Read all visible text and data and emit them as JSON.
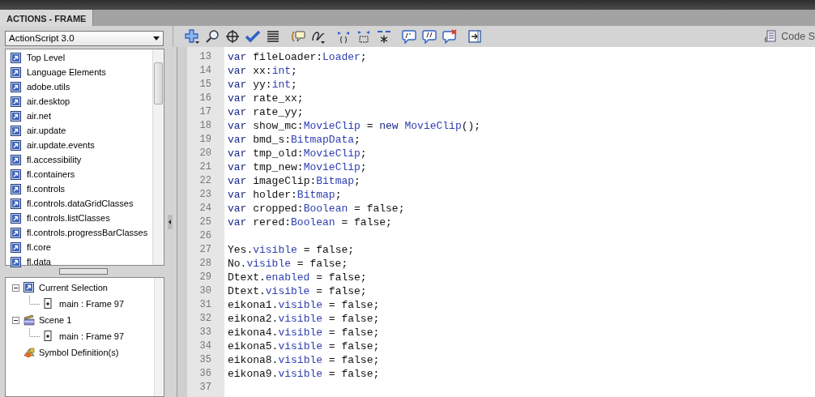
{
  "panel_tab": {
    "label": "ACTIONS - FRAME",
    "selected": true
  },
  "language_select": {
    "value": "ActionScript 3.0"
  },
  "toolbox_items": [
    {
      "label": "Top Level"
    },
    {
      "label": "Language Elements"
    },
    {
      "label": "adobe.utils"
    },
    {
      "label": "air.desktop"
    },
    {
      "label": "air.net"
    },
    {
      "label": "air.update"
    },
    {
      "label": "air.update.events"
    },
    {
      "label": "fl.accessibility"
    },
    {
      "label": "fl.containers"
    },
    {
      "label": "fl.controls"
    },
    {
      "label": "fl.controls.dataGridClasses"
    },
    {
      "label": "fl.controls.listClasses"
    },
    {
      "label": "fl.controls.progressBarClasses"
    },
    {
      "label": "fl.core"
    },
    {
      "label": "fl.data"
    }
  ],
  "script_tree": [
    {
      "label": "Current Selection",
      "kind": "selection",
      "expanded": true,
      "children": [
        {
          "label": "main : Frame 97",
          "kind": "frame"
        }
      ]
    },
    {
      "label": "Scene 1",
      "kind": "scene",
      "expanded": true,
      "children": [
        {
          "label": "main : Frame 97",
          "kind": "frame"
        }
      ]
    },
    {
      "label": "Symbol Definition(s)",
      "kind": "symbol"
    }
  ],
  "code_snippets_button": {
    "label": "Code S"
  },
  "code_lines": [
    {
      "number": "13",
      "tokens": [
        {
          "text": "var ",
          "kind": "keyword"
        },
        {
          "text": "fileLoader:",
          "kind": "plain"
        },
        {
          "text": "Loader",
          "kind": "type"
        },
        {
          "text": ";",
          "kind": "plain"
        }
      ]
    },
    {
      "number": "14",
      "tokens": [
        {
          "text": "var ",
          "kind": "keyword"
        },
        {
          "text": "xx:",
          "kind": "plain"
        },
        {
          "text": "int",
          "kind": "type"
        },
        {
          "text": ";",
          "kind": "plain"
        }
      ]
    },
    {
      "number": "15",
      "tokens": [
        {
          "text": "var ",
          "kind": "keyword"
        },
        {
          "text": "yy:",
          "kind": "plain"
        },
        {
          "text": "int",
          "kind": "type"
        },
        {
          "text": ";",
          "kind": "plain"
        }
      ]
    },
    {
      "number": "16",
      "tokens": [
        {
          "text": "var ",
          "kind": "keyword"
        },
        {
          "text": "rate_xx;",
          "kind": "plain"
        }
      ]
    },
    {
      "number": "17",
      "tokens": [
        {
          "text": "var ",
          "kind": "keyword"
        },
        {
          "text": "rate_yy;",
          "kind": "plain"
        }
      ]
    },
    {
      "number": "18",
      "tokens": [
        {
          "text": "var ",
          "kind": "keyword"
        },
        {
          "text": "show_mc:",
          "kind": "plain"
        },
        {
          "text": "MovieClip",
          "kind": "type"
        },
        {
          "text": " = ",
          "kind": "plain"
        },
        {
          "text": "new",
          "kind": "keyword"
        },
        {
          "text": " MovieClip",
          "kind": "type"
        },
        {
          "text": "();",
          "kind": "plain"
        }
      ]
    },
    {
      "number": "19",
      "tokens": [
        {
          "text": "var ",
          "kind": "keyword"
        },
        {
          "text": "bmd_s:",
          "kind": "plain"
        },
        {
          "text": "BitmapData",
          "kind": "type"
        },
        {
          "text": ";",
          "kind": "plain"
        }
      ]
    },
    {
      "number": "20",
      "tokens": [
        {
          "text": "var ",
          "kind": "keyword"
        },
        {
          "text": "tmp_old:",
          "kind": "plain"
        },
        {
          "text": "MovieClip",
          "kind": "type"
        },
        {
          "text": ";",
          "kind": "plain"
        }
      ]
    },
    {
      "number": "21",
      "tokens": [
        {
          "text": "var ",
          "kind": "keyword"
        },
        {
          "text": "tmp_new:",
          "kind": "plain"
        },
        {
          "text": "MovieClip",
          "kind": "type"
        },
        {
          "text": ";",
          "kind": "plain"
        }
      ]
    },
    {
      "number": "22",
      "tokens": [
        {
          "text": "var ",
          "kind": "keyword"
        },
        {
          "text": "imageClip:",
          "kind": "plain"
        },
        {
          "text": "Bitmap",
          "kind": "type"
        },
        {
          "text": ";",
          "kind": "plain"
        }
      ]
    },
    {
      "number": "23",
      "tokens": [
        {
          "text": "var ",
          "kind": "keyword"
        },
        {
          "text": "holder:",
          "kind": "plain"
        },
        {
          "text": "Bitmap",
          "kind": "type"
        },
        {
          "text": ";",
          "kind": "plain"
        }
      ]
    },
    {
      "number": "24",
      "tokens": [
        {
          "text": "var ",
          "kind": "keyword"
        },
        {
          "text": "cropped:",
          "kind": "plain"
        },
        {
          "text": "Boolean",
          "kind": "type"
        },
        {
          "text": " = false;",
          "kind": "plain"
        }
      ]
    },
    {
      "number": "25",
      "tokens": [
        {
          "text": "var ",
          "kind": "keyword"
        },
        {
          "text": "rered:",
          "kind": "plain"
        },
        {
          "text": "Boolean",
          "kind": "type"
        },
        {
          "text": " = false;",
          "kind": "plain"
        }
      ]
    },
    {
      "number": "26"
    },
    {
      "number": "27",
      "tokens": [
        {
          "text": "Yes.",
          "kind": "plain"
        },
        {
          "text": "visible",
          "kind": "type"
        },
        {
          "text": " = false;",
          "kind": "plain"
        }
      ]
    },
    {
      "number": "28",
      "tokens": [
        {
          "text": "No.",
          "kind": "plain"
        },
        {
          "text": "visible",
          "kind": "type"
        },
        {
          "text": " = false;",
          "kind": "plain"
        }
      ]
    },
    {
      "number": "29",
      "tokens": [
        {
          "text": "Dtext.",
          "kind": "plain"
        },
        {
          "text": "enabled",
          "kind": "type"
        },
        {
          "text": " = false;",
          "kind": "plain"
        }
      ]
    },
    {
      "number": "30",
      "tokens": [
        {
          "text": "Dtext.",
          "kind": "plain"
        },
        {
          "text": "visible",
          "kind": "type"
        },
        {
          "text": " = false;",
          "kind": "plain"
        }
      ]
    },
    {
      "number": "31",
      "tokens": [
        {
          "text": "eikona1.",
          "kind": "plain"
        },
        {
          "text": "visible",
          "kind": "type"
        },
        {
          "text": " = false;",
          "kind": "plain"
        }
      ]
    },
    {
      "number": "32",
      "tokens": [
        {
          "text": "eikona2.",
          "kind": "plain"
        },
        {
          "text": "visible",
          "kind": "type"
        },
        {
          "text": " = false;",
          "kind": "plain"
        }
      ]
    },
    {
      "number": "33",
      "tokens": [
        {
          "text": "eikona4.",
          "kind": "plain"
        },
        {
          "text": "visible",
          "kind": "type"
        },
        {
          "text": " = false;",
          "kind": "plain"
        }
      ]
    },
    {
      "number": "34",
      "tokens": [
        {
          "text": "eikona5.",
          "kind": "plain"
        },
        {
          "text": "visible",
          "kind": "type"
        },
        {
          "text": " = false;",
          "kind": "plain"
        }
      ]
    },
    {
      "number": "35",
      "tokens": [
        {
          "text": "eikona8.",
          "kind": "plain"
        },
        {
          "text": "visible",
          "kind": "type"
        },
        {
          "text": " = false;",
          "kind": "plain"
        }
      ]
    },
    {
      "number": "36",
      "tokens": [
        {
          "text": "eikona9.",
          "kind": "plain"
        },
        {
          "text": "visible",
          "kind": "type"
        },
        {
          "text": " = false;",
          "kind": "plain"
        }
      ]
    },
    {
      "number": "37"
    }
  ]
}
